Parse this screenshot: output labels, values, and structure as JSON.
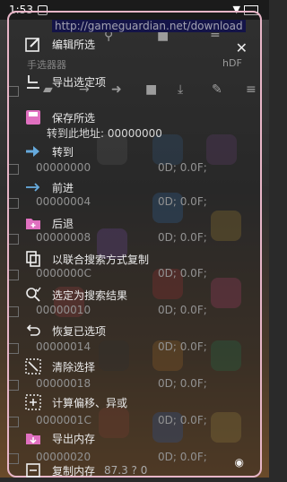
{
  "status_bar": {
    "time": "1:53"
  },
  "url_label": "http://gameguardian.net/download",
  "bg_labels": {
    "filter_label": "手选器器",
    "right_tag": "hDF"
  },
  "background_rows": [
    {
      "address": "00000000",
      "value": "0D; 0.0F;"
    },
    {
      "address": "00000004",
      "value": "0D; 0.0F;"
    },
    {
      "address": "00000008",
      "value": "0D; 0.0F;"
    },
    {
      "address": "0000000C",
      "value": "0D; 0.0F;"
    },
    {
      "address": "00000010",
      "value": "0D; 0.0F;"
    },
    {
      "address": "00000014",
      "value": "0D; 0.0F;"
    },
    {
      "address": "00000018",
      "value": "0D; 0.0F;"
    },
    {
      "address": "0000001C",
      "value": "0D; 0.0F;"
    },
    {
      "address": "00000020",
      "value": "0D; 0.0F;"
    }
  ],
  "menu": {
    "items": [
      {
        "label": "编辑所选",
        "icon": "edit-icon"
      },
      {
        "label": "导出选定项",
        "icon": "export-icon"
      },
      {
        "label": "保存所选",
        "icon": "save-icon"
      },
      {
        "label": "转到",
        "icon": "goto-arrow-icon"
      },
      {
        "label": "前进",
        "icon": "forward-arrow-icon"
      },
      {
        "label": "后退",
        "icon": "folder-plus-icon"
      },
      {
        "label": "以联合搜索方式复制",
        "icon": "copy-icon"
      },
      {
        "label": "选定为搜索结果",
        "icon": "search-check-icon"
      },
      {
        "label": "恢复已选项",
        "icon": "restore-icon"
      },
      {
        "label": "清除选择",
        "icon": "clear-selection-icon"
      },
      {
        "label": "计算偏移、异或",
        "icon": "calculate-icon"
      },
      {
        "label": "导出内存",
        "icon": "export-memory-icon"
      },
      {
        "label": "复制内存",
        "icon": "copy-memory-icon"
      }
    ],
    "save_subtext": "转到此地址:  00000000",
    "copy_memory_value": "87.3 ? 0"
  }
}
